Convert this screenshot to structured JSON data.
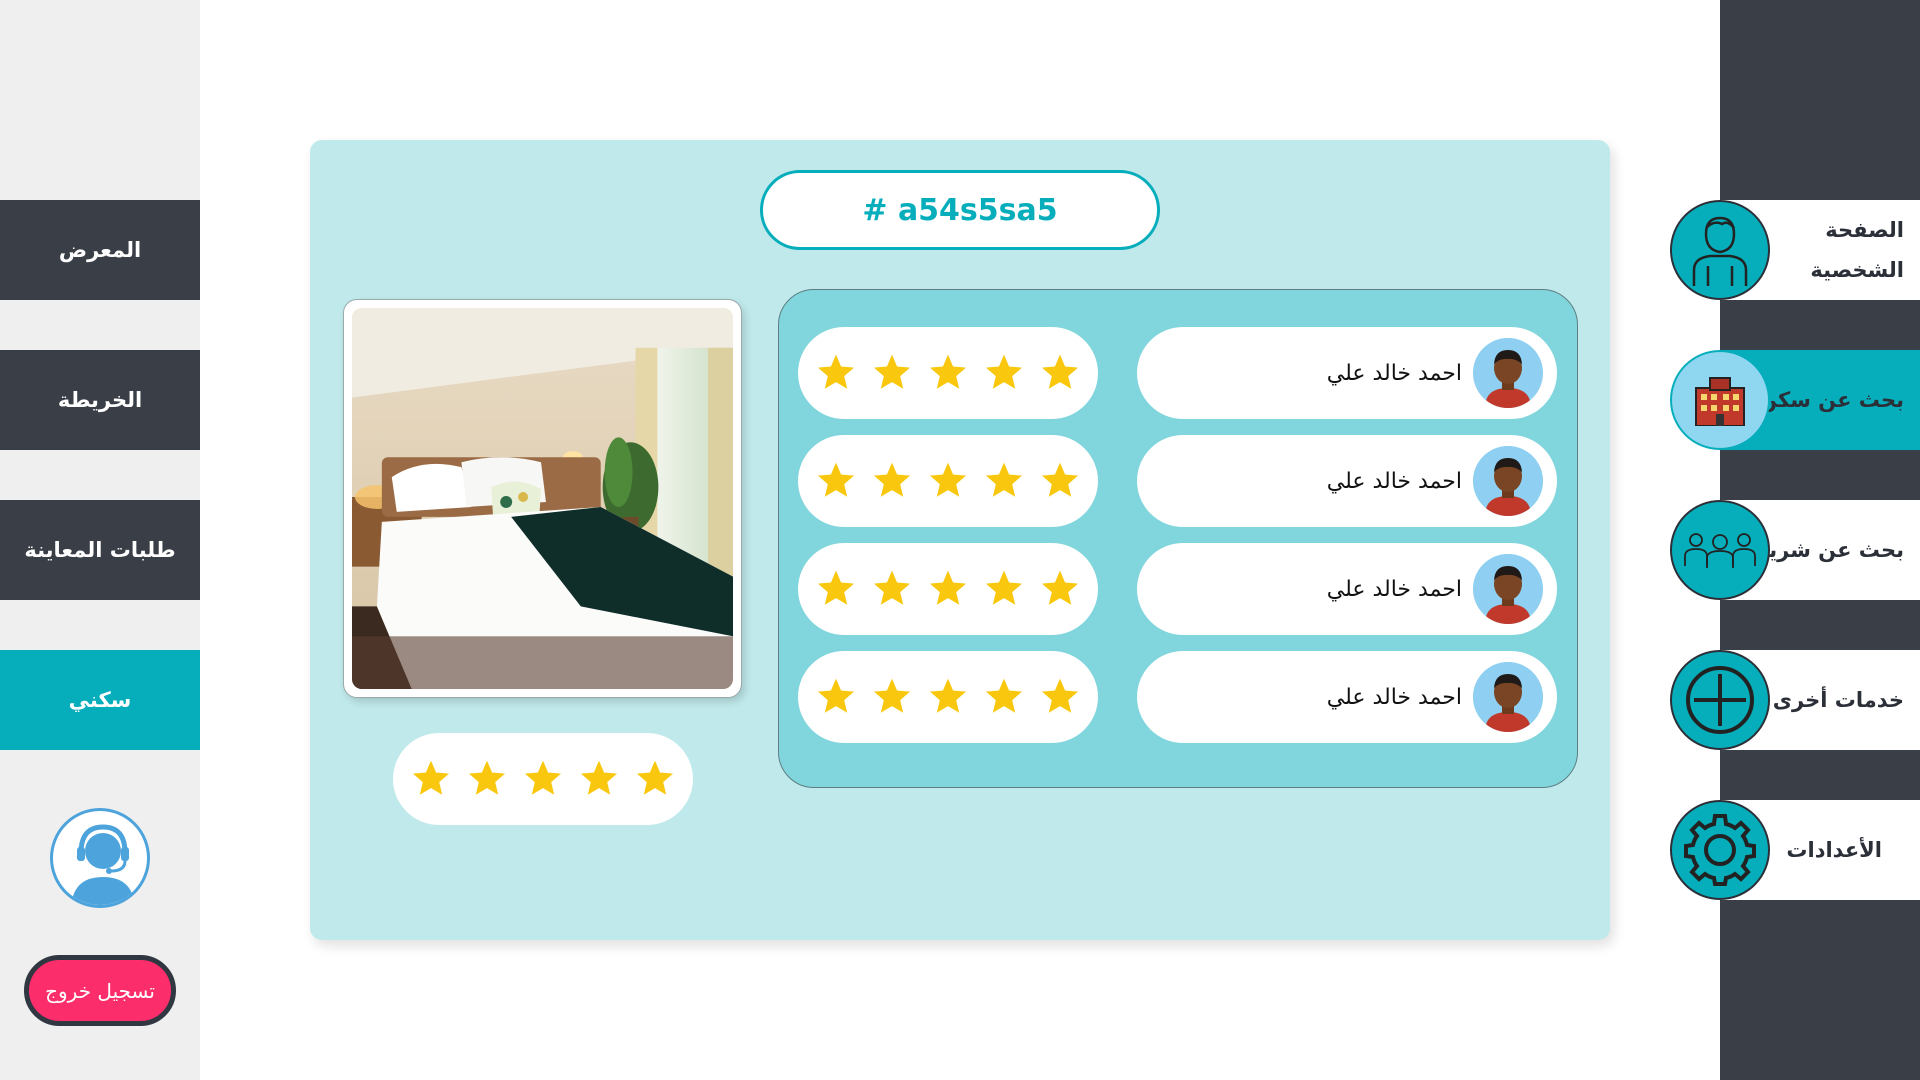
{
  "left_nav": {
    "items": [
      {
        "label": "المعرض"
      },
      {
        "label": "الخريطة"
      },
      {
        "label": "طلبات المعاينة"
      },
      {
        "label": "سكني"
      }
    ],
    "logout_label": "تسجيل خروج"
  },
  "right_nav": {
    "items": [
      {
        "label": "الصفحة الشخصية",
        "icon": "user-profile-icon"
      },
      {
        "label": "بحث عن سكن",
        "icon": "building-icon"
      },
      {
        "label": "بحث عن شريك",
        "icon": "group-people-icon"
      },
      {
        "label": "خدمات أخرى",
        "icon": "plus-circle-icon"
      },
      {
        "label": "الأعدادات",
        "icon": "gear-icon"
      }
    ]
  },
  "listing": {
    "id_label": "# a54s5sa5",
    "overall_rating": 5,
    "rating_max": 5
  },
  "reviews": [
    {
      "name": "احمد خالد علي",
      "rating": 5
    },
    {
      "name": "احمد خالد علي",
      "rating": 5
    },
    {
      "name": "احمد خالد علي",
      "rating": 5
    },
    {
      "name": "احمد خالد علي",
      "rating": 5
    }
  ],
  "colors": {
    "accent": "#06aebb",
    "dark": "#3a3e47",
    "panel": "#c0e9eb",
    "reviews_box": "#80d6dc",
    "star": "#f9c80e",
    "logout": "#fb2d6a"
  }
}
